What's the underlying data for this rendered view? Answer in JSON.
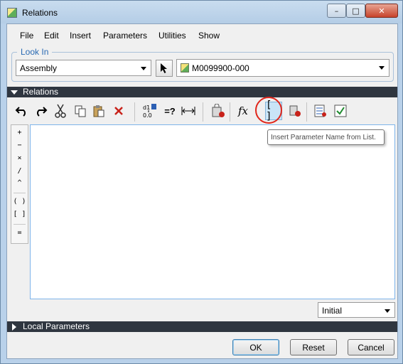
{
  "window": {
    "title": "Relations",
    "minimize_glyph": "–",
    "maximize_glyph": "□",
    "close_glyph": "✕"
  },
  "menubar": {
    "items": [
      "File",
      "Edit",
      "Insert",
      "Parameters",
      "Utilities",
      "Show"
    ]
  },
  "look_in": {
    "label": "Look In",
    "type_value": "Assembly",
    "model_value": "M0099900-000"
  },
  "relations_section": {
    "label": "Relations"
  },
  "toolbar": {
    "icons": [
      "undo-icon",
      "redo-icon",
      "cut-icon",
      "copy-icon",
      "paste-icon",
      "delete-icon",
      "show-values-icon",
      "evaluate-icon",
      "dimension-icon",
      "verify-icon",
      "function-icon",
      "insert-parameter-icon",
      "insert-from-list-icon",
      "sort-relations-icon",
      "verify-relations-icon"
    ],
    "function_glyph": "fx",
    "bracket_glyph": "[ ]",
    "evaluate_glyph": "=?"
  },
  "tooltip": {
    "text": "Insert Parameter Name from List."
  },
  "operators": [
    "+",
    "−",
    "×",
    "/",
    "^",
    "( )",
    "[ ]",
    "="
  ],
  "editor": {
    "content": ""
  },
  "relation_order": {
    "value": "Initial"
  },
  "local_parameters_section": {
    "label": "Local Parameters"
  },
  "buttons": {
    "ok": "OK",
    "reset": "Reset",
    "cancel": "Cancel"
  },
  "colors": {
    "accent": "#2a6ab3",
    "section_bar": "#2f3640",
    "highlight_circle": "#e0261b"
  }
}
